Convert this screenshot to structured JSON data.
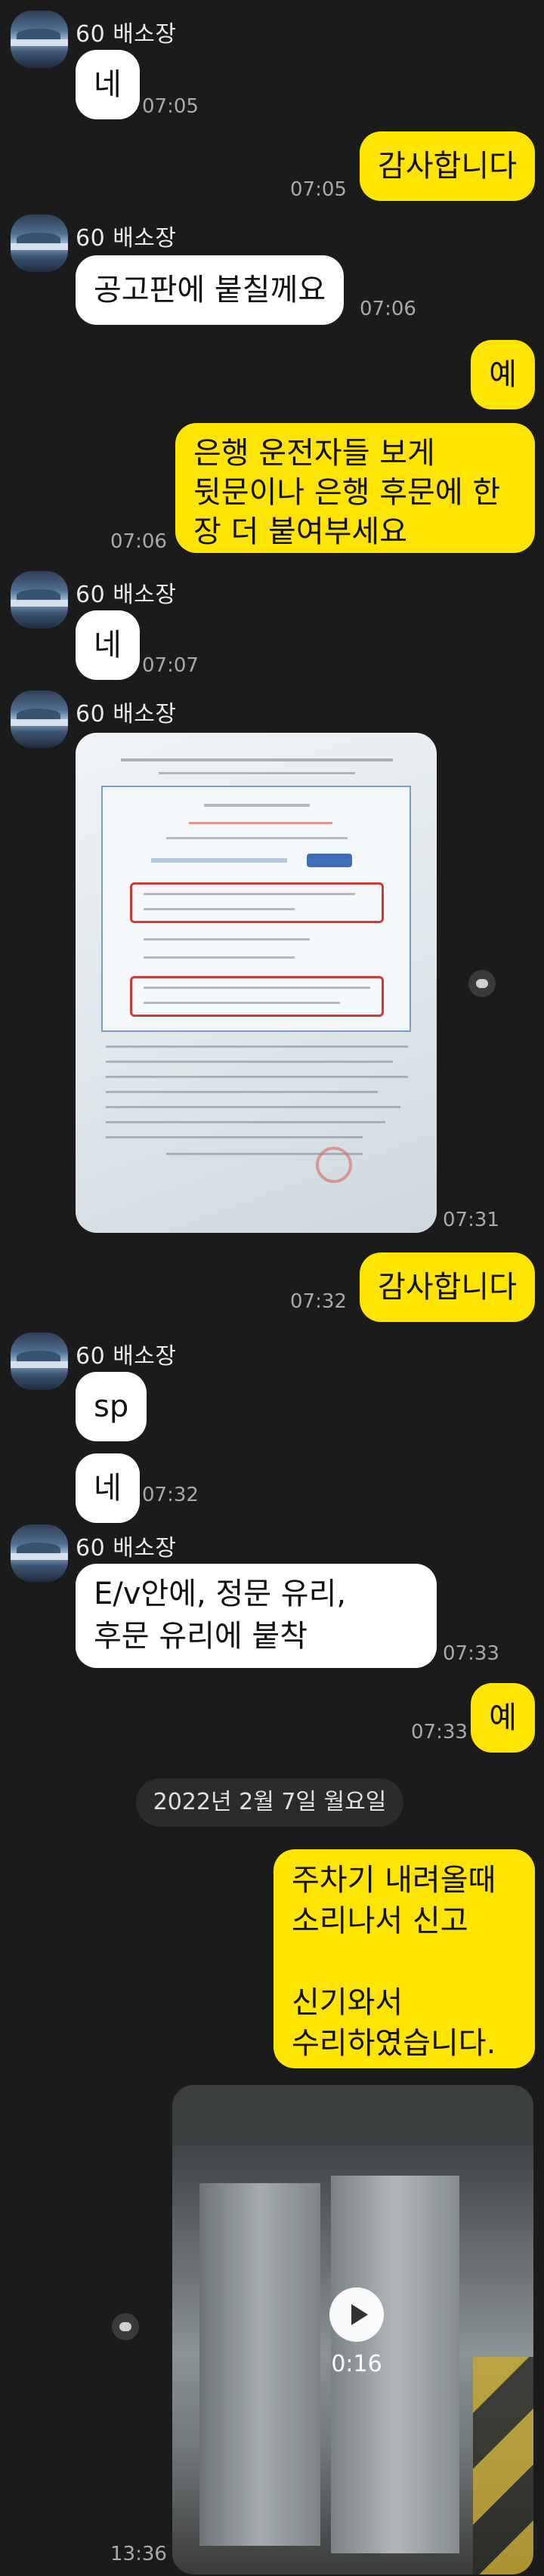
{
  "sender_name": "60 배소장",
  "date_divider": "2022년 2월 7일 월요일",
  "messages": [
    {
      "side": "left",
      "type": "text",
      "text": "네",
      "time": "07:05"
    },
    {
      "side": "right",
      "type": "text",
      "text": "감사합니다",
      "time": "07:05"
    },
    {
      "side": "left",
      "type": "text",
      "text": "공고판에 붙칠께요",
      "time": "07:06"
    },
    {
      "side": "right",
      "type": "text",
      "text": "예",
      "time": ""
    },
    {
      "side": "right",
      "type": "text",
      "text": "은행 운전자들 보게\n뒷문이나 은행 후문에 한\n장 더 붙여부세요",
      "time": "07:06"
    },
    {
      "side": "left",
      "type": "text",
      "text": "네",
      "time": "07:07"
    },
    {
      "side": "left",
      "type": "image",
      "time": "07:31"
    },
    {
      "side": "right",
      "type": "text",
      "text": "감사합니다",
      "time": "07:32"
    },
    {
      "side": "left",
      "type": "text",
      "text": "sp",
      "time": ""
    },
    {
      "side": "left",
      "type": "text",
      "text": "네",
      "time": "07:32"
    },
    {
      "side": "left",
      "type": "text",
      "text": "E/v안에, 정문 유리,\n후문 유리에 붙착",
      "time": "07:33"
    },
    {
      "side": "right",
      "type": "text",
      "text": "예",
      "time": "07:33"
    },
    {
      "side": "right",
      "type": "text",
      "text": "주차기 내려올때\n소리나서 신고\n\n신기와서\n수리하였습니다.",
      "time": ""
    },
    {
      "side": "right",
      "type": "video",
      "duration": "0:16",
      "time": "13:36"
    }
  ],
  "colors": {
    "background": "#1b1b1b",
    "received_bubble": "#ffffff",
    "sent_bubble": "#fee500",
    "timestamp": "#a9a9a9"
  },
  "icons": {
    "avatar": "profile-avatar",
    "share": "chat-bubble-icon",
    "video_play": "play-icon"
  }
}
